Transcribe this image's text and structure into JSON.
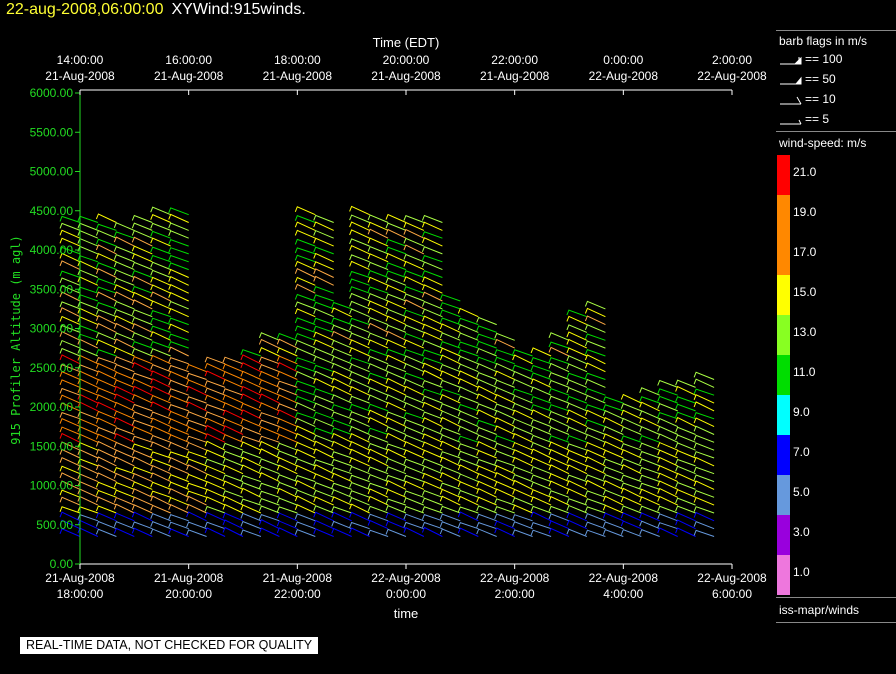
{
  "title": {
    "datetime": "22-aug-2008,06:00:00",
    "product": "XYWind:915winds."
  },
  "chart_data": {
    "type": "scatter",
    "marker": "wind-barb",
    "top_axis": {
      "label": "Time (EDT)",
      "ticks": [
        {
          "t": "14:00:00",
          "d": "21-Aug-2008"
        },
        {
          "t": "16:00:00",
          "d": "21-Aug-2008"
        },
        {
          "t": "18:00:00",
          "d": "21-Aug-2008"
        },
        {
          "t": "20:00:00",
          "d": "21-Aug-2008"
        },
        {
          "t": "22:00:00",
          "d": "21-Aug-2008"
        },
        {
          "t": "0:00:00",
          "d": "22-Aug-2008"
        },
        {
          "t": "2:00:00",
          "d": "22-Aug-2008"
        }
      ]
    },
    "bottom_axis": {
      "label": "time",
      "ticks": [
        {
          "d": "21-Aug-2008",
          "t": "18:00:00"
        },
        {
          "d": "21-Aug-2008",
          "t": "20:00:00"
        },
        {
          "d": "21-Aug-2008",
          "t": "22:00:00"
        },
        {
          "d": "22-Aug-2008",
          "t": "0:00:00"
        },
        {
          "d": "22-Aug-2008",
          "t": "2:00:00"
        },
        {
          "d": "22-Aug-2008",
          "t": "4:00:00"
        },
        {
          "d": "22-Aug-2008",
          "t": "6:00:00"
        }
      ]
    },
    "xlim_hours": [
      18,
      30
    ],
    "y_axis": {
      "label": "915 Profiler Altitude (m agl)",
      "ylim": [
        0,
        6000
      ],
      "ticks": [
        "0.00",
        "500.00",
        "1000.00",
        "1500.00",
        "2000.00",
        "2500.00",
        "3000.00",
        "3500.00",
        "4000.00",
        "4500.00",
        "5000.00",
        "5500.00",
        "6000.00"
      ]
    },
    "profiles": [
      {
        "hour": 18.0,
        "top": 4400
      },
      {
        "hour": 18.33,
        "top": 4350
      },
      {
        "hour": 18.67,
        "top": 4350
      },
      {
        "hour": 19.0,
        "top": 4300
      },
      {
        "hour": 19.33,
        "top": 4350
      },
      {
        "hour": 19.67,
        "top": 4500
      },
      {
        "hour": 20.0,
        "top": 4450
      },
      {
        "hour": 20.33,
        "top": 2450
      },
      {
        "hour": 20.67,
        "top": 2550
      },
      {
        "hour": 21.0,
        "top": 2600
      },
      {
        "hour": 21.33,
        "top": 2700
      },
      {
        "hour": 21.67,
        "top": 2850
      },
      {
        "hour": 22.0,
        "top": 2900
      },
      {
        "hour": 22.33,
        "top": 4500
      },
      {
        "hour": 22.67,
        "top": 4350
      },
      {
        "hour": 23.0,
        "top": 3300
      },
      {
        "hour": 23.33,
        "top": 4450
      },
      {
        "hour": 23.67,
        "top": 4400
      },
      {
        "hour": 24.0,
        "top": 4400
      },
      {
        "hour": 24.33,
        "top": 4400
      },
      {
        "hour": 24.67,
        "top": 4350
      },
      {
        "hour": 25.0,
        "top": 3350
      },
      {
        "hour": 25.33,
        "top": 3150
      },
      {
        "hour": 25.67,
        "top": 3100
      },
      {
        "hour": 26.0,
        "top": 2850
      },
      {
        "hour": 26.33,
        "top": 2650
      },
      {
        "hour": 26.67,
        "top": 2650
      },
      {
        "hour": 27.0,
        "top": 2850
      },
      {
        "hour": 27.33,
        "top": 3150
      },
      {
        "hour": 27.67,
        "top": 3250
      },
      {
        "hour": 28.0,
        "top": 2050
      },
      {
        "hour": 28.33,
        "top": 2050
      },
      {
        "hour": 28.67,
        "top": 2150
      },
      {
        "hour": 29.0,
        "top": 2250
      },
      {
        "hour": 29.33,
        "top": 2300
      },
      {
        "hour": 29.67,
        "top": 2400
      }
    ]
  },
  "legend": {
    "barb_title": "barb flags in m/s",
    "barbs": [
      {
        "label": "== 100",
        "kind": "100"
      },
      {
        "label": "== 50",
        "kind": "50"
      },
      {
        "label": "== 10",
        "kind": "10"
      },
      {
        "label": "== 5",
        "kind": "5"
      }
    ],
    "speed_title": "wind-speed: m/s",
    "speed_scale": [
      {
        "label": "21.0",
        "color": "#ff0000"
      },
      {
        "label": "19.0",
        "color": "#ff8800"
      },
      {
        "label": "17.0",
        "color": "#ff8800"
      },
      {
        "label": "15.0",
        "color": "#ffff00"
      },
      {
        "label": "13.0",
        "color": "#88ff22"
      },
      {
        "label": "11.0",
        "color": "#00dd00"
      },
      {
        "label": "9.0",
        "color": "#00ffff"
      },
      {
        "label": "7.0",
        "color": "#0000ff"
      },
      {
        "label": "5.0",
        "color": "#6699dd"
      },
      {
        "label": "3.0",
        "color": "#9900dd"
      },
      {
        "label": "1.0",
        "color": "#ee77dd"
      }
    ],
    "panel_label": "iss-mapr/winds"
  },
  "disclaimer": "REAL-TIME DATA, NOT CHECKED FOR QUALITY"
}
